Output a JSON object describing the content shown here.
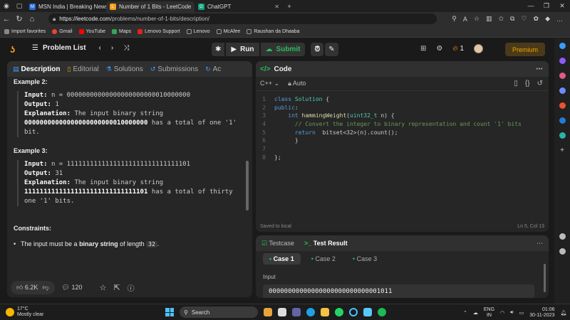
{
  "browser": {
    "tabs": [
      {
        "label": "MSN India | Breaking News, Ente",
        "color": "#2b6cd9",
        "glyph": "M",
        "active": false
      },
      {
        "label": "Number of 1 Bits - LeetCode",
        "color": "#f89f1b",
        "glyph": "L",
        "active": true
      },
      {
        "label": "ChatGPT",
        "color": "#10a37f",
        "glyph": "G",
        "active": false
      }
    ],
    "url_host": "https://leetcode.com",
    "url_path": "/problems/number-of-1-bits/description/",
    "bookmarks": [
      {
        "label": "Import favorites",
        "color": "#888"
      },
      {
        "label": "Gmail",
        "color": "#ea4335"
      },
      {
        "label": "YouTube",
        "color": "#ff0000"
      },
      {
        "label": "Maps",
        "color": "#34a853"
      },
      {
        "label": "Lenovo Support",
        "color": "#e2231a"
      },
      {
        "label": "Lenovo",
        "color": "#999"
      },
      {
        "label": "McAfee",
        "color": "#999"
      },
      {
        "label": "Raushan da Dhaaba",
        "color": "#999"
      }
    ]
  },
  "header": {
    "problem_list": "Problem List",
    "run": "Run",
    "submit": "Submit",
    "streak": "1",
    "premium": "Premium"
  },
  "description": {
    "tabs": [
      "Description",
      "Editorial",
      "Solutions",
      "Submissions",
      "Ac"
    ],
    "example2": {
      "heading": "Example 2:",
      "input_label": "Input:",
      "input": "n = 00000000000000000000000010000000",
      "output_label": "Output:",
      "output": "1",
      "expl_label": "Explanation:",
      "expl_a": "The input binary string",
      "expl_bold": "00000000000000000000000010000000",
      "expl_b": "has a total of one '1'",
      "expl_c": "bit."
    },
    "example3": {
      "heading": "Example 3:",
      "input_label": "Input:",
      "input": "n = 11111111111111111111111111111101",
      "output_label": "Output:",
      "output": "31",
      "expl_label": "Explanation:",
      "expl_a": "The input binary string",
      "expl_bold": "11111111111111111111111111111101",
      "expl_b": "has a total of thirty",
      "expl_c": "one '1' bits."
    },
    "constraints_heading": "Constraints:",
    "constraint_a": "The input must be a",
    "constraint_bold": "binary string",
    "constraint_b": "of length",
    "constraint_len": "32",
    "constraint_end": ".",
    "likes": "6.2K",
    "comments": "120"
  },
  "editor": {
    "title": "Code",
    "language": "C++",
    "mode": "Auto",
    "lines": [
      {
        "n": "1",
        "html": "<span class='kw'>class</span> <span class='ty'>Solution</span> <span class='tx'>{</span>"
      },
      {
        "n": "2",
        "html": "<span class='kw'>public</span><span class='tx'>:</span>"
      },
      {
        "n": "3",
        "html": "    <span class='kw'>int</span> <span class='fn'>hammingWeight</span><span class='tx'>(</span><span class='ty'>uint32_t</span> <span class='tx'>n) {</span>"
      },
      {
        "n": "4",
        "html": "      <span class='cm'>// Convert the integer to binary representation and count '1' bits</span>"
      },
      {
        "n": "5",
        "html": "      <span class='kw'>return</span>  <span class='tx'>bitset&lt;32&gt;(n).count();</span>"
      },
      {
        "n": "6",
        "html": "      <span class='tx'>}</span>"
      },
      {
        "n": "7",
        "html": ""
      },
      {
        "n": "8",
        "html": "<span class='tx'>};</span>"
      }
    ],
    "saved": "Saved to local",
    "cursor": "Ln 5, Col 13"
  },
  "tests": {
    "testcase_tab": "Testcase",
    "result_tab": "Test Result",
    "cases": [
      "Case 1",
      "Case 2",
      "Case 3"
    ],
    "input_label": "Input",
    "input_value": "00000000000000000000000000001011"
  },
  "taskbar": {
    "temp": "17°C",
    "weather": "Mostly clear",
    "search": "Search",
    "lang": "ENG",
    "region": "IN",
    "time": "01:06",
    "date": "30-11-2023"
  }
}
